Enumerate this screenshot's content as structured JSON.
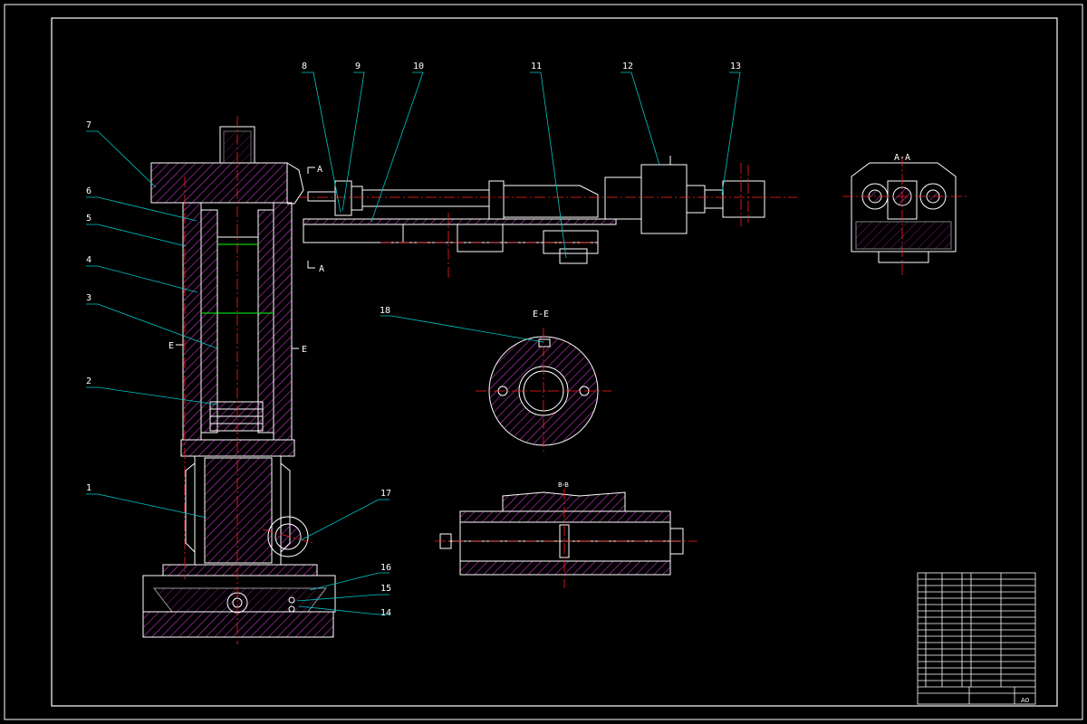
{
  "colors": {
    "background": "#000000",
    "outline": "#ffffff",
    "hatch": "#c837c8",
    "centerline": "#ff2020",
    "leader": "#00c8c8",
    "dimension": "#00ff00"
  },
  "part_labels": [
    "1",
    "2",
    "3",
    "4",
    "5",
    "6",
    "7",
    "8",
    "9",
    "10",
    "11",
    "12",
    "13",
    "14",
    "15",
    "16",
    "17",
    "18"
  ],
  "section_labels": {
    "aa_top": "A",
    "aa_bottom": "A",
    "aa_view": "A-A",
    "ee_view": "E-E",
    "ee_left": "E",
    "ee_right": "E",
    "bb_view": "B-B"
  },
  "title_block": {
    "sheet_size": "A0"
  }
}
